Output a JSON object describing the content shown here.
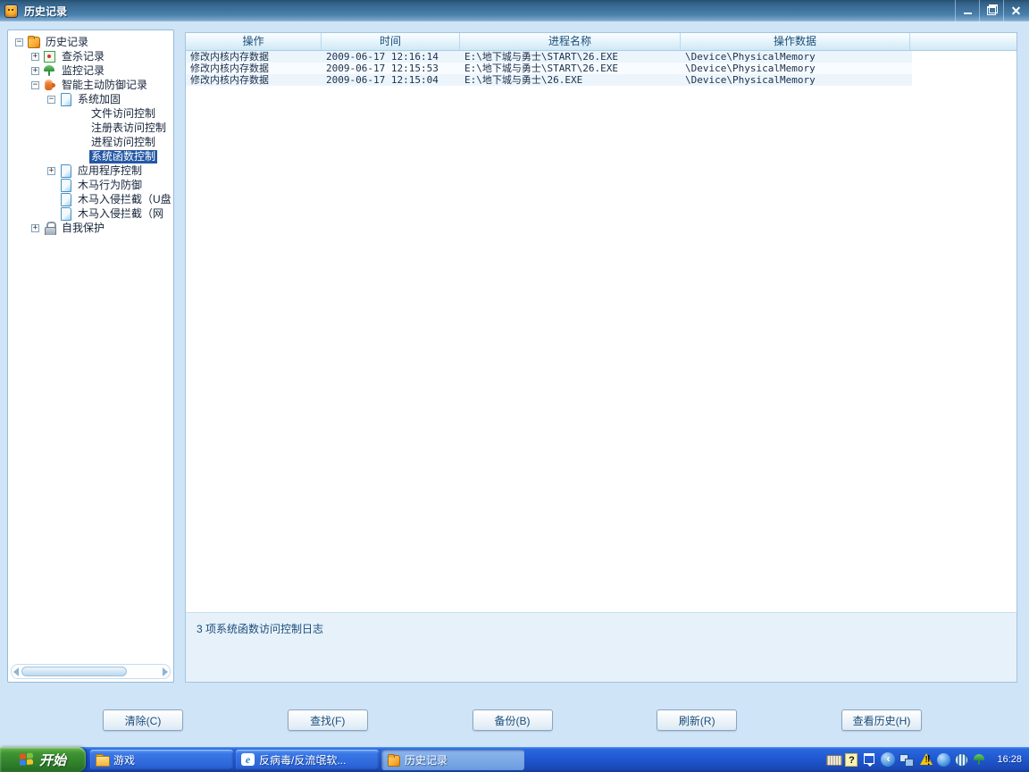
{
  "window": {
    "title": "历史记录",
    "controls": [
      "minimize",
      "restore",
      "close"
    ]
  },
  "tree": {
    "items": [
      {
        "label": "历史记录",
        "level": 0,
        "expand": "-",
        "icon": "folder-icon",
        "selected": false
      },
      {
        "label": "查杀记录",
        "level": 1,
        "expand": "+",
        "icon": "scan-record-icon",
        "selected": false
      },
      {
        "label": "监控记录",
        "level": 1,
        "expand": "+",
        "icon": "umbrella-icon",
        "selected": false
      },
      {
        "label": "智能主动防御记录",
        "level": 1,
        "expand": "-",
        "icon": "defense-hand-icon",
        "selected": false
      },
      {
        "label": "系统加固",
        "level": 2,
        "expand": "-",
        "icon": "document-icon",
        "selected": false
      },
      {
        "label": "文件访问控制",
        "level": 3,
        "expand": "",
        "icon": "",
        "selected": false
      },
      {
        "label": "注册表访问控制",
        "level": 3,
        "expand": "",
        "icon": "",
        "selected": false
      },
      {
        "label": "进程访问控制",
        "level": 3,
        "expand": "",
        "icon": "",
        "selected": false
      },
      {
        "label": "系统函数控制",
        "level": 3,
        "expand": "",
        "icon": "",
        "selected": true
      },
      {
        "label": "应用程序控制",
        "level": 2,
        "expand": "+",
        "icon": "document-icon",
        "selected": false
      },
      {
        "label": "木马行为防御",
        "level": 2,
        "expand": "",
        "icon": "document-icon",
        "selected": false
      },
      {
        "label": "木马入侵拦截（U盘",
        "level": 2,
        "expand": "",
        "icon": "document-icon",
        "selected": false
      },
      {
        "label": "木马入侵拦截（网",
        "level": 2,
        "expand": "",
        "icon": "document-icon",
        "selected": false
      },
      {
        "label": "自我保护",
        "level": 1,
        "expand": "+",
        "icon": "lock-icon",
        "selected": false
      }
    ]
  },
  "table": {
    "columns": [
      "操作",
      "时间",
      "进程名称",
      "操作数据",
      ""
    ],
    "rows": [
      [
        "修改内核内存数据",
        "2009-06-17 12:16:14",
        "E:\\地下城与勇士\\START\\26.EXE",
        "\\Device\\PhysicalMemory"
      ],
      [
        "修改内核内存数据",
        "2009-06-17 12:15:53",
        "E:\\地下城与勇士\\START\\26.EXE",
        "\\Device\\PhysicalMemory"
      ],
      [
        "修改内核内存数据",
        "2009-06-17 12:15:04",
        "E:\\地下城与勇士\\26.EXE",
        "\\Device\\PhysicalMemory"
      ]
    ]
  },
  "status": {
    "text": "3 项系统函数访问控制日志"
  },
  "buttons": [
    {
      "label": "清除(C)"
    },
    {
      "label": "查找(F)"
    },
    {
      "label": "备份(B)"
    },
    {
      "label": "刷新(R)"
    },
    {
      "label": "查看历史(H)"
    }
  ],
  "taskbar": {
    "start_label": "开始",
    "tasks": [
      {
        "label": "游戏",
        "icon": "game-folder-icon",
        "active": false
      },
      {
        "label": "反病毒/反流氓软...",
        "icon": "ie-icon",
        "active": false
      },
      {
        "label": "历史记录",
        "icon": "folder-icon",
        "active": true
      }
    ],
    "tray": {
      "icons": [
        "keyboard-icon",
        "help-icon",
        "restore-window-icon",
        "collapse-chevron-icon",
        "network-icon",
        "alert-icon",
        "globe-icon",
        "striped-ball-icon",
        "umbrella-icon"
      ],
      "time": "16:28"
    }
  },
  "colors": {
    "titlebar_blue": "#3f739e",
    "window_bg": "#cfe4f6",
    "selection_blue": "#2457a4",
    "header_text": "#1b4d7a",
    "taskbar_blue": "#2058d2",
    "start_green": "#2f7d2a"
  }
}
